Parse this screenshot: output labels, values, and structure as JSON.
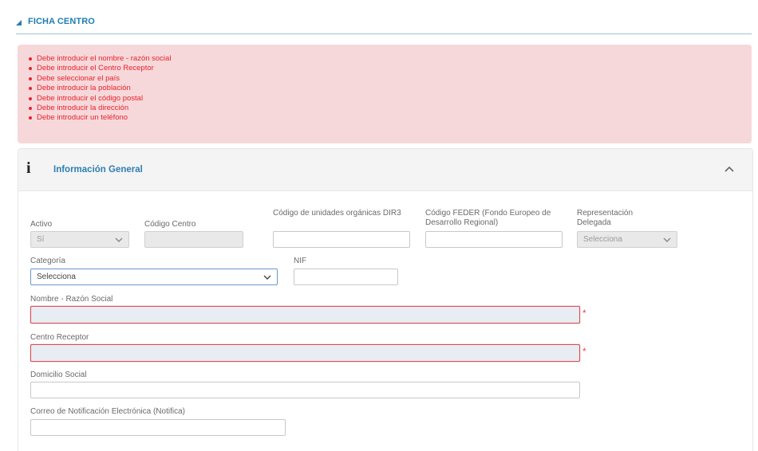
{
  "section": {
    "title": "FICHA CENTRO"
  },
  "alert": {
    "messages": [
      "Debe introducir el nombre - razón social",
      "Debe introducir el Centro Receptor",
      "Debe seleccionar el país",
      "Debe introducir la población",
      "Debe introducir el código postal",
      "Debe introducir la dirección",
      "Debe introducir un teléfono"
    ]
  },
  "panel": {
    "title": "Información General"
  },
  "form": {
    "activo": {
      "label": "Activo",
      "value": "Sí"
    },
    "codigo_centro": {
      "label": "Código Centro",
      "value": ""
    },
    "dir3": {
      "label": "Código de unidades orgánicas DIR3",
      "value": ""
    },
    "feder": {
      "label": "Código FEDER (Fondo Europeo de Desarrollo Regional)",
      "value": ""
    },
    "representacion": {
      "label": "Representación Delegada",
      "value": "Selecciona"
    },
    "categoria": {
      "label": "Categoría",
      "value": "Selecciona"
    },
    "nif": {
      "label": "NIF",
      "value": ""
    },
    "nombre": {
      "label": "Nombre - Razón Social",
      "value": ""
    },
    "centro_receptor": {
      "label": "Centro Receptor",
      "value": ""
    },
    "domicilio": {
      "label": "Domicilio Social",
      "value": ""
    },
    "correo": {
      "label": "Correo de Notificación Electrónica (Notifica)",
      "value": ""
    },
    "required_marker": "*"
  },
  "colors": {
    "accent": "#1e7db3",
    "error": "#e8232d",
    "alert_bg": "#f6d8da"
  }
}
